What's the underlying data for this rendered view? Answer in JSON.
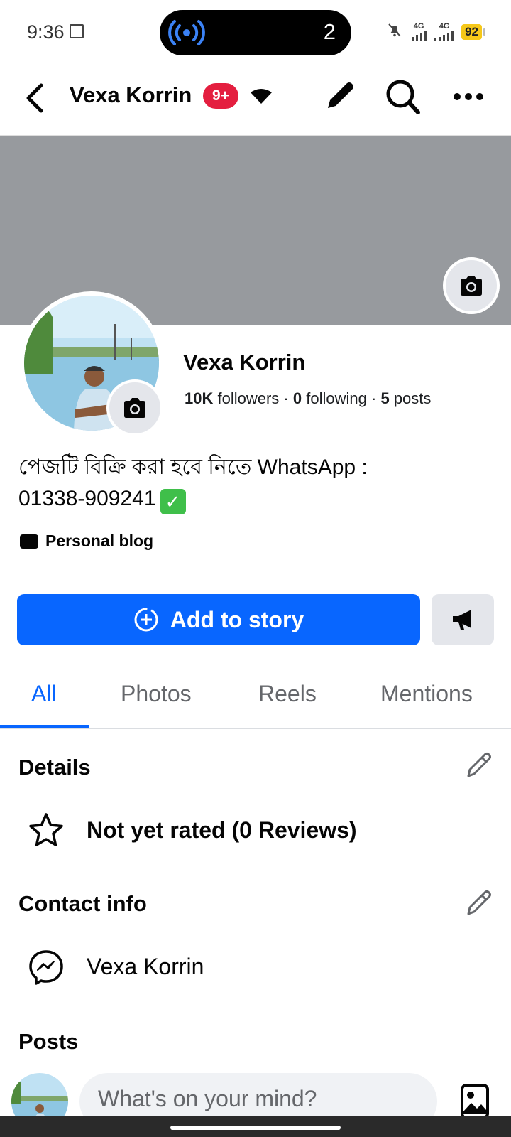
{
  "status_bar": {
    "time": "9:36",
    "cast_count": "2",
    "network_1": "4G",
    "network_2": "4G",
    "battery": "92"
  },
  "header": {
    "page_name": "Vexa Korrin",
    "notification_badge": "9+"
  },
  "profile": {
    "name": "Vexa Korrin",
    "followers_count": "10K",
    "followers_label": "followers",
    "following_count": "0",
    "following_label": "following",
    "posts_count": "5",
    "posts_label": "posts",
    "bio_line1": "পেজটি বিক্রি করা হবে নিতে WhatsApp :",
    "bio_line2": "01338-909241",
    "category": "Personal blog"
  },
  "actions": {
    "add_story": "Add to story"
  },
  "tabs": [
    {
      "label": "All",
      "active": true
    },
    {
      "label": "Photos",
      "active": false
    },
    {
      "label": "Reels",
      "active": false
    },
    {
      "label": "Mentions",
      "active": false
    }
  ],
  "details": {
    "title": "Details",
    "rating": "Not yet rated (0 Reviews)"
  },
  "contact": {
    "title": "Contact info",
    "messenger": "Vexa Korrin"
  },
  "posts": {
    "title": "Posts",
    "composer_placeholder": "What's on your mind?"
  },
  "colors": {
    "accent": "#0866ff",
    "badge": "#e41e3f",
    "cover": "#979a9e"
  }
}
